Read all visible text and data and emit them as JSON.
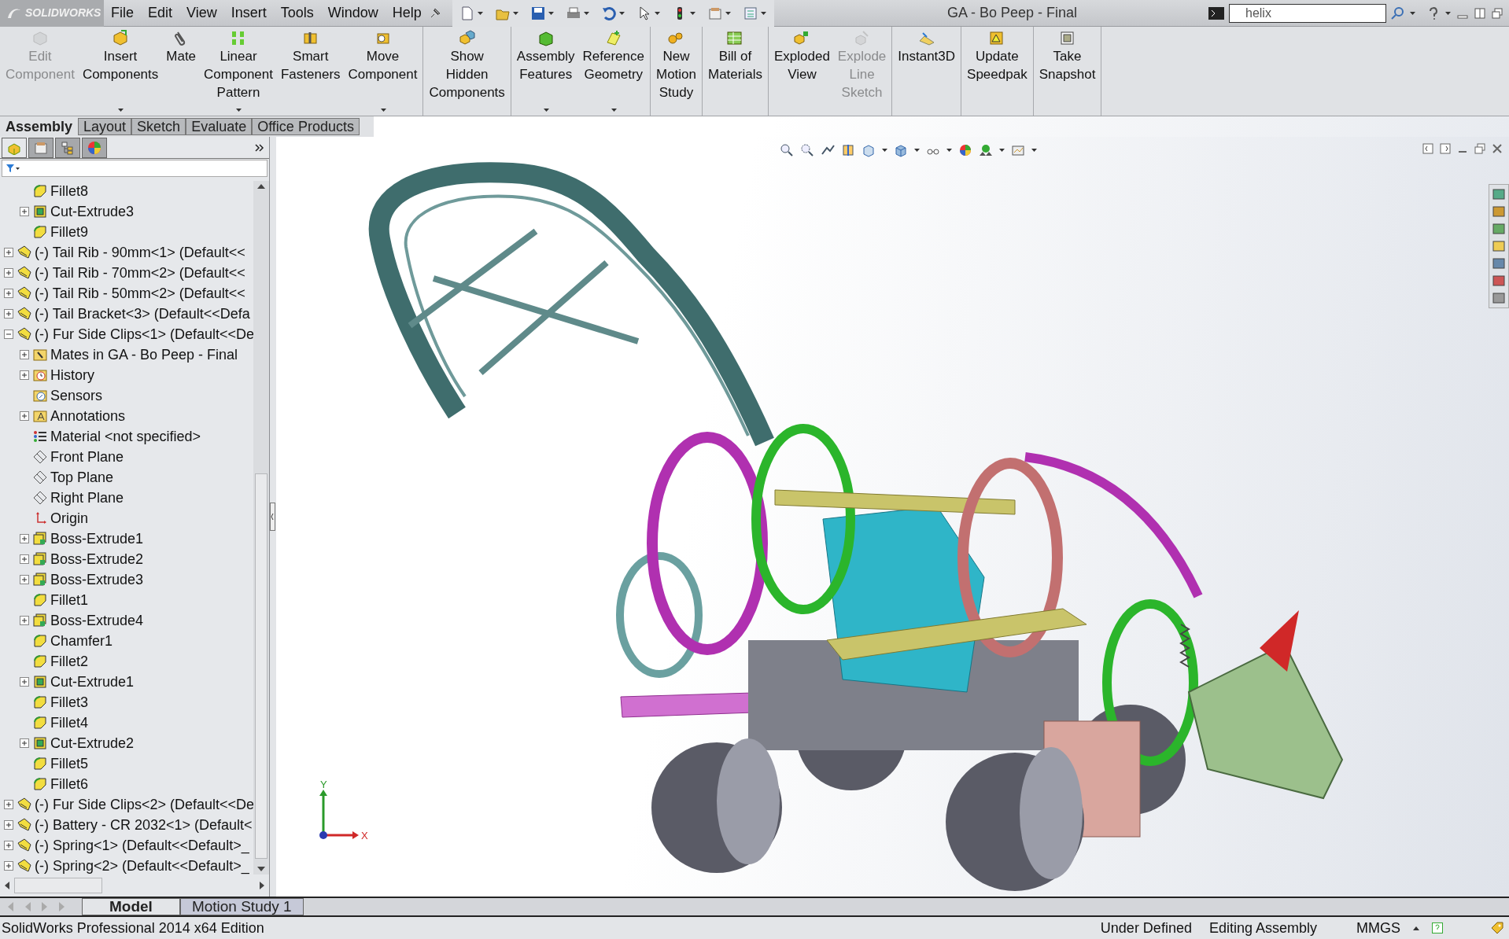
{
  "window": {
    "title": "GA - Bo Peep - Final",
    "logo": "SOLIDWORKS"
  },
  "menu": [
    "File",
    "Edit",
    "View",
    "Insert",
    "Tools",
    "Window",
    "Help"
  ],
  "search": {
    "value": "helix"
  },
  "ribbon": {
    "groups": [
      [
        {
          "label": "Edit\nComponent",
          "disabled": true,
          "dropdown": false
        },
        {
          "label": "Insert\nComponents",
          "disabled": false,
          "dropdown": true
        },
        {
          "label": "Mate",
          "disabled": false,
          "dropdown": false
        },
        {
          "label": "Linear\nComponent\nPattern",
          "disabled": false,
          "dropdown": true
        },
        {
          "label": "Smart\nFasteners",
          "disabled": false,
          "dropdown": false
        },
        {
          "label": "Move\nComponent",
          "disabled": false,
          "dropdown": true
        }
      ],
      [
        {
          "label": "Show\nHidden\nComponents",
          "disabled": false,
          "dropdown": false
        }
      ],
      [
        {
          "label": "Assembly\nFeatures",
          "disabled": false,
          "dropdown": true
        },
        {
          "label": "Reference\nGeometry",
          "disabled": false,
          "dropdown": true
        }
      ],
      [
        {
          "label": "New\nMotion\nStudy",
          "disabled": false,
          "dropdown": false
        }
      ],
      [
        {
          "label": "Bill of\nMaterials",
          "disabled": false,
          "dropdown": false
        }
      ],
      [
        {
          "label": "Exploded\nView",
          "disabled": false,
          "dropdown": false
        },
        {
          "label": "Explode\nLine\nSketch",
          "disabled": true,
          "dropdown": false
        }
      ],
      [
        {
          "label": "Instant3D",
          "disabled": false,
          "dropdown": false
        }
      ],
      [
        {
          "label": "Update\nSpeedpak",
          "disabled": false,
          "dropdown": false
        }
      ],
      [
        {
          "label": "Take\nSnapshot",
          "disabled": false,
          "dropdown": false
        }
      ]
    ]
  },
  "command_tabs": [
    {
      "label": "Assembly",
      "selected": true
    },
    {
      "label": "Layout",
      "selected": false
    },
    {
      "label": "Sketch",
      "selected": false
    },
    {
      "label": "Evaluate",
      "selected": false
    },
    {
      "label": "Office Products",
      "selected": false
    }
  ],
  "panel_tabs": [
    {
      "kind": "feature",
      "selected": true
    },
    {
      "kind": "property",
      "selected": false
    },
    {
      "kind": "config",
      "selected": false
    },
    {
      "kind": "display",
      "selected": false
    }
  ],
  "tree": {
    "items": [
      {
        "children": [
          {
            "label": "Fillet8",
            "kind": "fillet"
          },
          {
            "label": "Cut-Extrude3",
            "kind": "cut",
            "expanded": false
          },
          {
            "label": "Fillet9",
            "kind": "fillet"
          }
        ]
      },
      {
        "label": "(-) Tail Rib - 90mm<1> (Default<<",
        "kind": "part",
        "expanded": false
      },
      {
        "label": "(-) Tail Rib - 70mm<2> (Default<<",
        "kind": "part",
        "expanded": false
      },
      {
        "label": "(-) Tail Rib - 50mm<2> (Default<<",
        "kind": "part",
        "expanded": false
      },
      {
        "label": "(-) Tail Bracket<3> (Default<<Defa",
        "kind": "part",
        "expanded": false
      },
      {
        "label": "(-) Fur Side Clips<1> (Default<<De",
        "kind": "part",
        "expanded": true,
        "children": [
          {
            "label": "Mates in GA - Bo Peep - Final",
            "kind": "mates",
            "expanded": false
          },
          {
            "label": "History",
            "kind": "history",
            "expanded": false
          },
          {
            "label": "Sensors",
            "kind": "sensors"
          },
          {
            "label": "Annotations",
            "kind": "annotations",
            "expanded": false
          },
          {
            "label": "Material <not specified>",
            "kind": "material"
          },
          {
            "label": "Front Plane",
            "kind": "plane"
          },
          {
            "label": "Top Plane",
            "kind": "plane"
          },
          {
            "label": "Right Plane",
            "kind": "plane"
          },
          {
            "label": "Origin",
            "kind": "origin"
          },
          {
            "label": "Boss-Extrude1",
            "kind": "boss",
            "expanded": false
          },
          {
            "label": "Boss-Extrude2",
            "kind": "boss",
            "expanded": false
          },
          {
            "label": "Boss-Extrude3",
            "kind": "boss",
            "expanded": false
          },
          {
            "label": "Fillet1",
            "kind": "fillet"
          },
          {
            "label": "Boss-Extrude4",
            "kind": "boss",
            "expanded": false
          },
          {
            "label": "Chamfer1",
            "kind": "fillet"
          },
          {
            "label": "Fillet2",
            "kind": "fillet"
          },
          {
            "label": "Cut-Extrude1",
            "kind": "cut",
            "expanded": false
          },
          {
            "label": "Fillet3",
            "kind": "fillet"
          },
          {
            "label": "Fillet4",
            "kind": "fillet"
          },
          {
            "label": "Cut-Extrude2",
            "kind": "cut",
            "expanded": false
          },
          {
            "label": "Fillet5",
            "kind": "fillet"
          },
          {
            "label": "Fillet6",
            "kind": "fillet"
          }
        ]
      },
      {
        "label": "(-) Fur Side Clips<2> (Default<<De",
        "kind": "part",
        "expanded": false
      },
      {
        "label": "(-) Battery - CR 2032<1> (Default<",
        "kind": "part",
        "expanded": false
      },
      {
        "label": "(-) Spring<1> (Default<<Default>_",
        "kind": "part",
        "expanded": false
      },
      {
        "label": "(-) Spring<2> (Default<<Default>_",
        "kind": "part",
        "expanded": false
      }
    ]
  },
  "triad": {
    "x": "X",
    "y": "Y"
  },
  "bottom_tabs": [
    {
      "label": "Model",
      "selected": true
    },
    {
      "label": "Motion Study 1",
      "selected": false
    }
  ],
  "status_bar": {
    "edition": "SolidWorks Professional 2014 x64 Edition",
    "definition": "Under Defined",
    "mode": "Editing Assembly",
    "units": "MMGS"
  }
}
